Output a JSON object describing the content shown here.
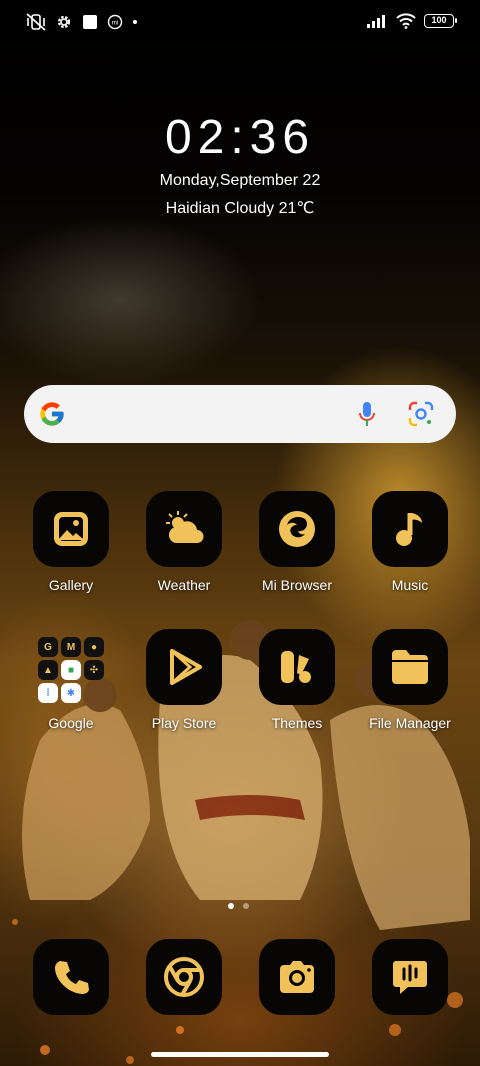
{
  "status_bar": {
    "left_icons": [
      "vibrate-off-icon",
      "gear-icon",
      "white-square-icon",
      "mi-icon",
      "dot-icon"
    ],
    "right_icons": [
      "signal-icon",
      "wifi-icon",
      "battery-icon"
    ],
    "battery_level": "100"
  },
  "clock": {
    "time": "02:36",
    "date": "Monday,September 22",
    "weather": "Haidian Cloudy 21℃"
  },
  "search": {
    "icons": [
      "google-logo-icon",
      "mic-icon",
      "google-lens-icon"
    ]
  },
  "apps": {
    "gallery": "Gallery",
    "weather": "Weather",
    "mi_browser": "Mi Browser",
    "music": "Music",
    "google": "Google",
    "play_store": "Play Store",
    "themes": "Themes",
    "file_manager": "File Manager"
  },
  "google_folder_icons": [
    "G",
    "M",
    "maps",
    "drive",
    "meet",
    "photos",
    "assistant",
    "gemini",
    "ai"
  ],
  "dock": [
    "phone-icon",
    "chrome-icon",
    "camera-icon",
    "messages-icon"
  ],
  "pages": {
    "count": 2,
    "active": 1
  },
  "colors": {
    "icon_accent": "#f2c25a",
    "icon_background": "#080604",
    "search_background": "#f3f3f3"
  }
}
